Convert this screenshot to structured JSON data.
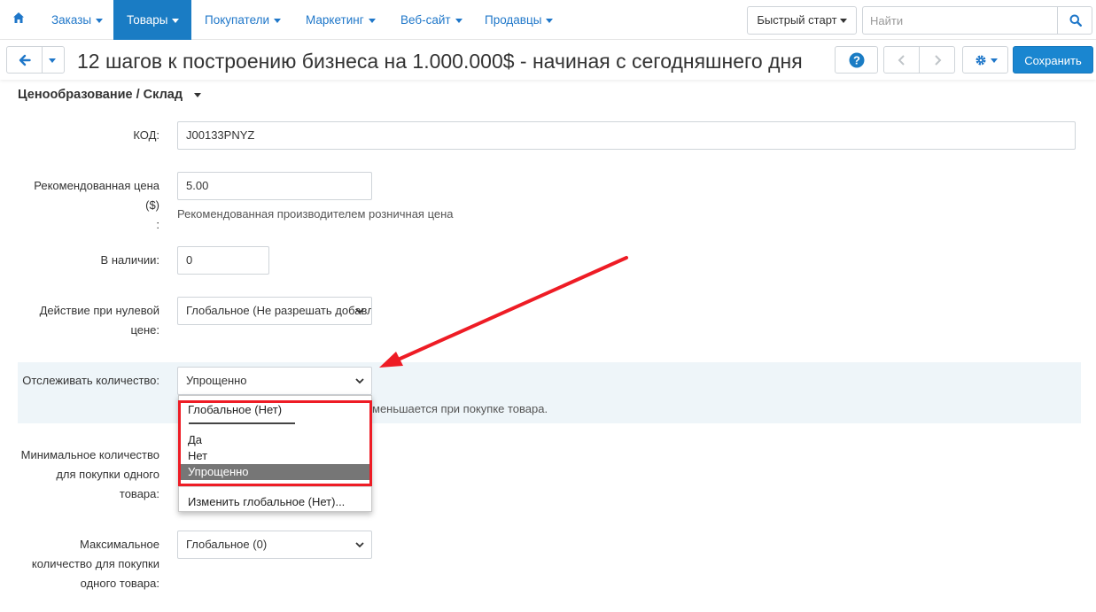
{
  "nav": {
    "items": [
      {
        "label": "Заказы"
      },
      {
        "label": "Товары"
      },
      {
        "label": "Покупатели"
      },
      {
        "label": "Маркетинг"
      },
      {
        "label": "Веб-сайт"
      },
      {
        "label": "Продавцы"
      }
    ],
    "active_item": "Товары",
    "quick_start_label": "Быстрый старт",
    "search_placeholder": "Найти",
    "icons": [
      "home-icon",
      "search-icon"
    ]
  },
  "titlebar": {
    "title": "12 шагов к построению бизнеса на 1.000.000$ - начиная с сегодняшнего дня",
    "save_label": "Сохранить",
    "icons": [
      "arrow-left-icon",
      "chevron-down-icon",
      "help-icon",
      "chevron-left-icon",
      "chevron-right-icon",
      "gear-icon"
    ]
  },
  "section": {
    "title": "Ценообразование / Склад"
  },
  "form": {
    "code": {
      "label": "КОД:",
      "value": "J00133PNYZ"
    },
    "list_price": {
      "label_line1": "Рекомендованная цена ($)",
      "label_line2": ":",
      "value": "5.00",
      "help": "Рекомендованная производителем розничная цена"
    },
    "in_stock": {
      "label": "В наличии:",
      "value": "0"
    },
    "zero_price_action": {
      "label_line1": "Действие при нулевой",
      "label_line2": "цене:",
      "value": "Глобальное (Не разрешать добавлять товар в корзину)"
    },
    "track_inventory": {
      "label": "Отслеживать количество:",
      "value": "Упрощенно",
      "help": "меньшается при покупке товара."
    },
    "min_qty": {
      "label_line1": "Минимальное количество",
      "label_line2": "для покупки одного",
      "label_line3": "товара:"
    },
    "max_qty": {
      "label_line1": "Максимальное",
      "label_line2": "количество для покупки",
      "label_line3": "одного товара:",
      "value": "Глобальное (0)"
    }
  },
  "dropdown": {
    "options": [
      {
        "label": "Глобальное (Нет)"
      },
      {
        "label": "Да"
      },
      {
        "label": "Нет"
      },
      {
        "label": "Упрощенно"
      },
      {
        "label": "Изменить глобальное (Нет)..."
      }
    ],
    "selected": "Упрощенно"
  },
  "annotation": {
    "color": "#ee1c25"
  }
}
